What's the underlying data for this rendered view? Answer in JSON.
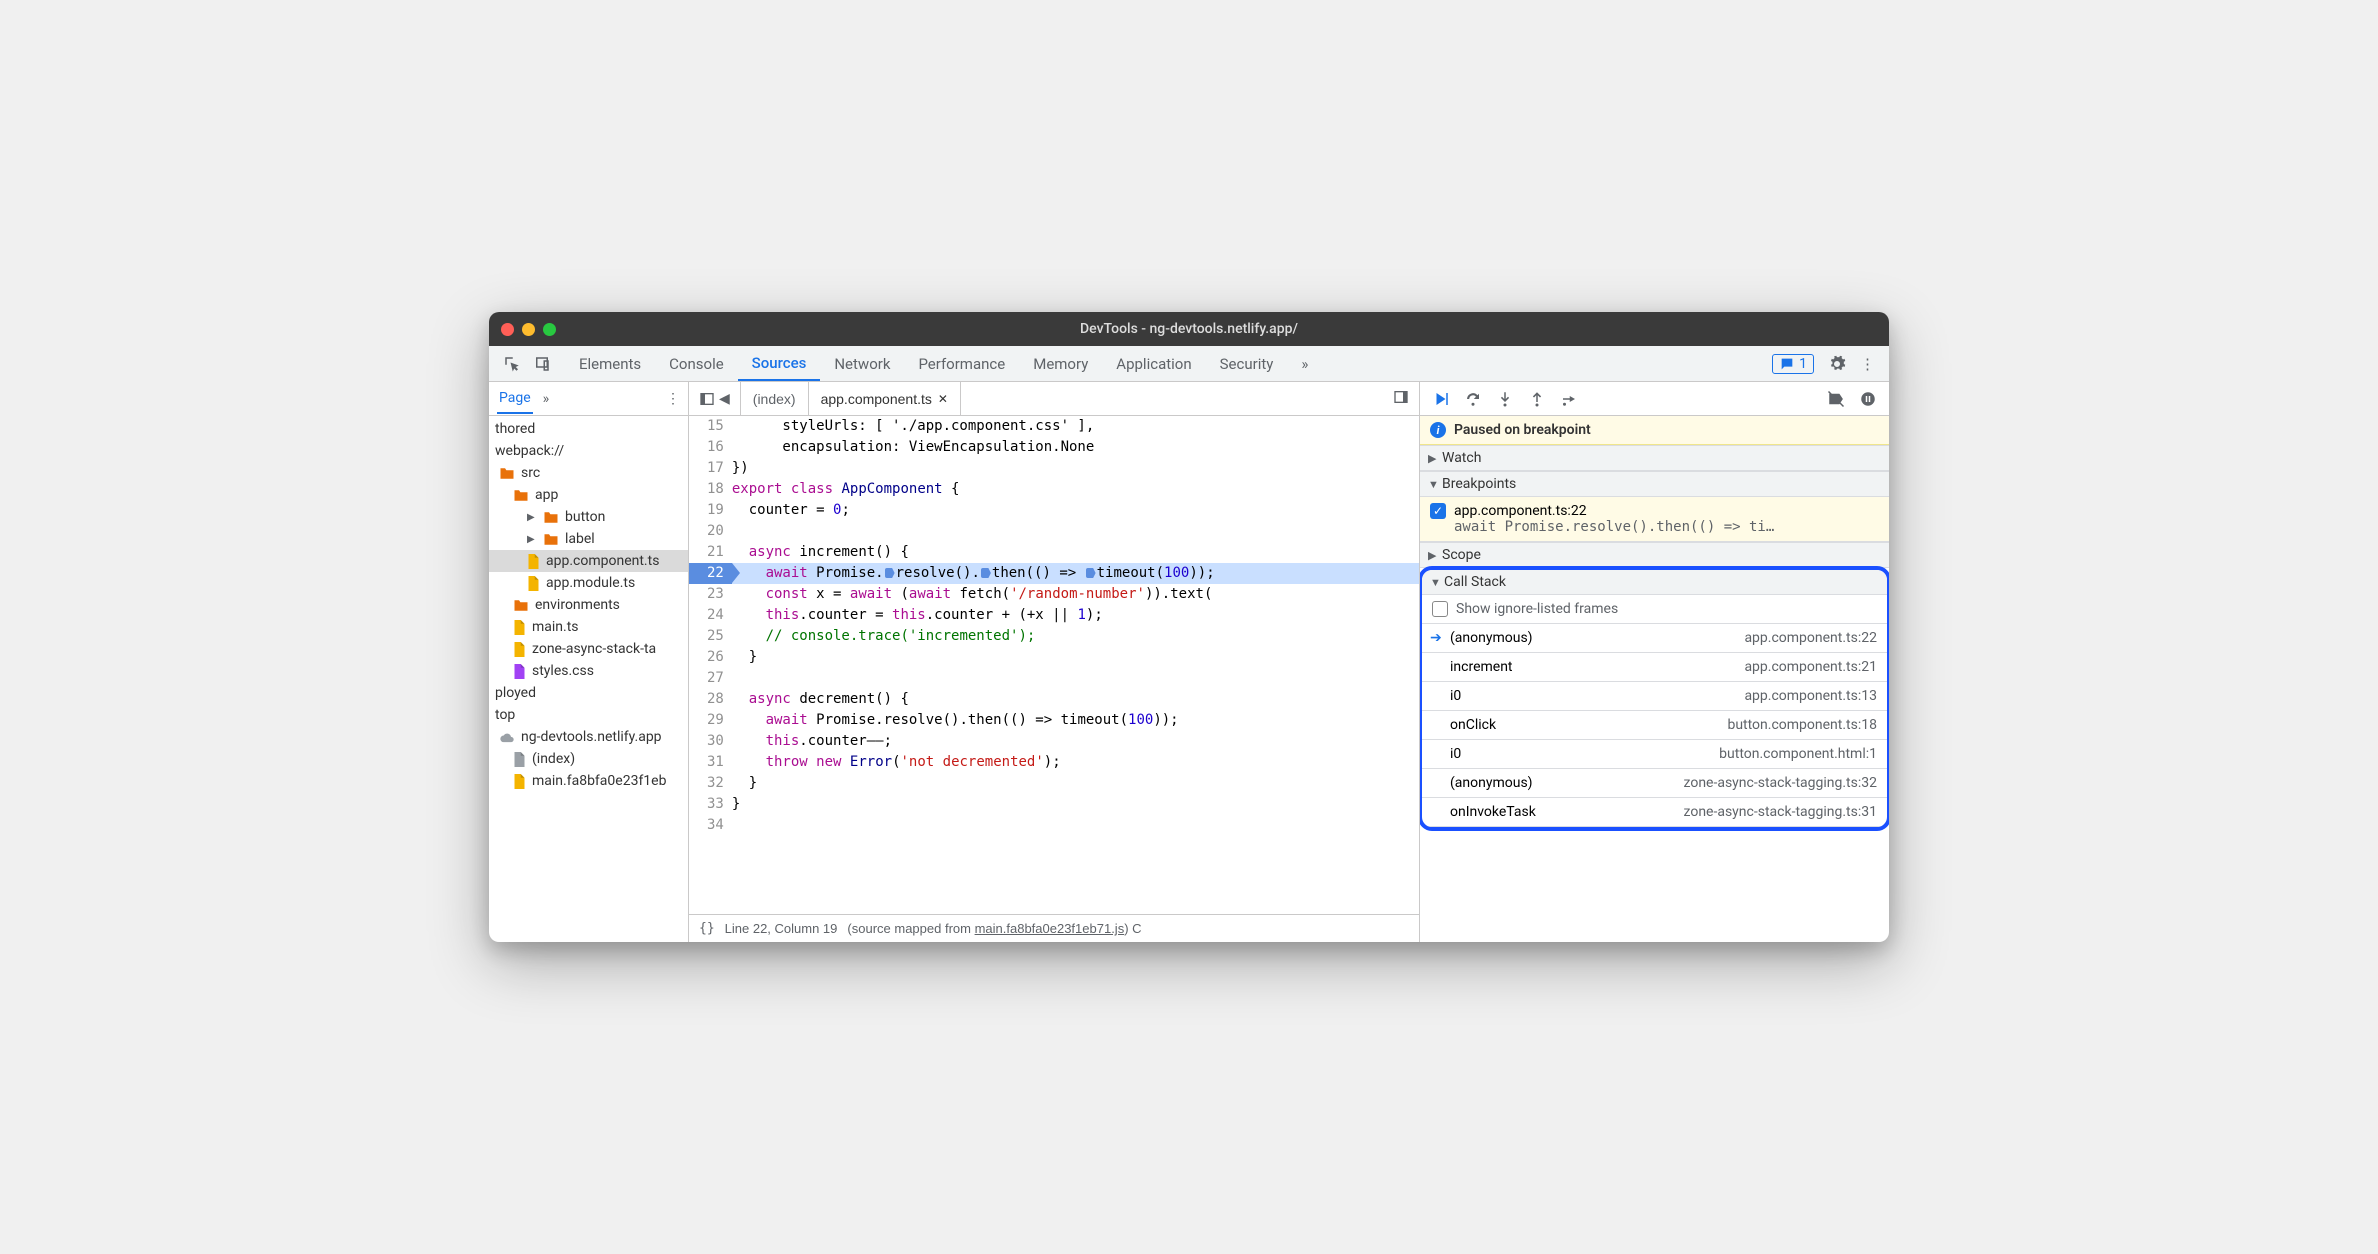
{
  "titlebar": {
    "title": "DevTools - ng-devtools.netlify.app/"
  },
  "mainTabs": {
    "items": [
      "Elements",
      "Console",
      "Sources",
      "Network",
      "Performance",
      "Memory",
      "Application",
      "Security"
    ],
    "activeIndex": 2,
    "badgeCount": "1"
  },
  "filenav": {
    "tab": "Page",
    "items": [
      {
        "label": "thored",
        "indent": 0,
        "type": "text"
      },
      {
        "label": "webpack://",
        "indent": 0,
        "type": "text"
      },
      {
        "label": "src",
        "indent": 1,
        "type": "folder",
        "color": "#e8710a"
      },
      {
        "label": "app",
        "indent": 2,
        "type": "folder",
        "color": "#e8710a"
      },
      {
        "label": "button",
        "indent": 3,
        "type": "folder",
        "color": "#e8710a",
        "arrow": true
      },
      {
        "label": "label",
        "indent": 3,
        "type": "folder",
        "color": "#e8710a",
        "arrow": true
      },
      {
        "label": "app.component.ts",
        "indent": 3,
        "type": "file",
        "color": "#f4b400",
        "selected": true
      },
      {
        "label": "app.module.ts",
        "indent": 3,
        "type": "file",
        "color": "#f4b400"
      },
      {
        "label": "environments",
        "indent": 2,
        "type": "folder",
        "color": "#e8710a"
      },
      {
        "label": "main.ts",
        "indent": 2,
        "type": "file",
        "color": "#f4b400"
      },
      {
        "label": "zone-async-stack-ta",
        "indent": 2,
        "type": "file",
        "color": "#f4b400"
      },
      {
        "label": "styles.css",
        "indent": 2,
        "type": "file",
        "color": "#a142f4"
      },
      {
        "label": "ployed",
        "indent": 0,
        "type": "text"
      },
      {
        "label": "top",
        "indent": 0,
        "type": "text"
      },
      {
        "label": "ng-devtools.netlify.app",
        "indent": 1,
        "type": "cloud"
      },
      {
        "label": "(index)",
        "indent": 2,
        "type": "file",
        "color": "#9aa0a6"
      },
      {
        "label": "main.fa8bfa0e23f1eb",
        "indent": 2,
        "type": "file",
        "color": "#f4b400"
      }
    ]
  },
  "editor": {
    "tabs": [
      {
        "label": "(index)",
        "active": false,
        "closable": false
      },
      {
        "label": "app.component.ts",
        "active": true,
        "closable": true
      }
    ],
    "startLine": 15,
    "execLine": 22,
    "lines": [
      {
        "raw": "      styleUrls: [ './app.component.css' ],"
      },
      {
        "raw": "      encapsulation: ViewEncapsulation.None"
      },
      {
        "raw": "})"
      },
      {
        "html": "<span class='k-keyword'>export</span> <span class='k-keyword'>class</span> <span class='k-type'>AppComponent</span> {"
      },
      {
        "html": "  counter = <span class='k-num'>0</span>;"
      },
      {
        "raw": ""
      },
      {
        "html": "  <span class='k-async'>async</span> <span class='k-prop'>increment</span>() {"
      },
      {
        "exec": true,
        "html": "    <span class='k-await'>await</span> Promise.<span class='marker'></span>resolve().<span class='marker'></span>then(() => <span class='marker'></span>timeout(<span class='k-num'>100</span>));"
      },
      {
        "html": "    <span class='k-keyword'>const</span> x = <span class='k-await'>await</span> (<span class='k-await'>await</span> fetch(<span class='k-str'>'/random-number'</span>)).text("
      },
      {
        "html": "    <span class='k-this'>this</span>.counter = <span class='k-this'>this</span>.counter + (+x || <span class='k-num'>1</span>);"
      },
      {
        "html": "    <span class='k-comment'>// console.trace('incremented');</span>"
      },
      {
        "raw": "  }"
      },
      {
        "raw": ""
      },
      {
        "html": "  <span class='k-async'>async</span> <span class='k-prop'>decrement</span>() {"
      },
      {
        "html": "    <span class='k-await'>await</span> Promise.resolve().then(() => timeout(<span class='k-num'>100</span>));"
      },
      {
        "html": "    <span class='k-this'>this</span>.counter––;"
      },
      {
        "html": "    <span class='k-keyword'>throw</span> <span class='k-keyword'>new</span> <span class='k-type'>Error</span>(<span class='k-str'>'not decremented'</span>);"
      },
      {
        "raw": "  }"
      },
      {
        "raw": "}"
      },
      {
        "raw": ""
      }
    ],
    "statusbar": {
      "pretty": "{}",
      "position": "Line 22, Column 19",
      "mapped_prefix": "(source mapped from ",
      "mapped_link": "main.fa8bfa0e23f1eb71.js",
      "mapped_suffix": ") C"
    }
  },
  "debugger": {
    "paused": "Paused on breakpoint",
    "sections": {
      "watch": "Watch",
      "breakpoints": "Breakpoints",
      "scope": "Scope",
      "callstack": "Call Stack"
    },
    "breakpoint": {
      "file": "app.component.ts:22",
      "code": "await Promise.resolve().then(() => ti…"
    },
    "showIgnored": "Show ignore-listed frames",
    "frames": [
      {
        "name": "(anonymous)",
        "loc": "app.component.ts:22",
        "current": true
      },
      {
        "name": "increment",
        "loc": "app.component.ts:21"
      },
      {
        "name": "i0",
        "loc": "app.component.ts:13"
      },
      {
        "name": "onClick",
        "loc": "button.component.ts:18"
      },
      {
        "name": "i0",
        "loc": "button.component.html:1"
      },
      {
        "name": "(anonymous)",
        "loc": "zone-async-stack-tagging.ts:32"
      },
      {
        "name": "onInvokeTask",
        "loc": "zone-async-stack-tagging.ts:31"
      }
    ]
  }
}
